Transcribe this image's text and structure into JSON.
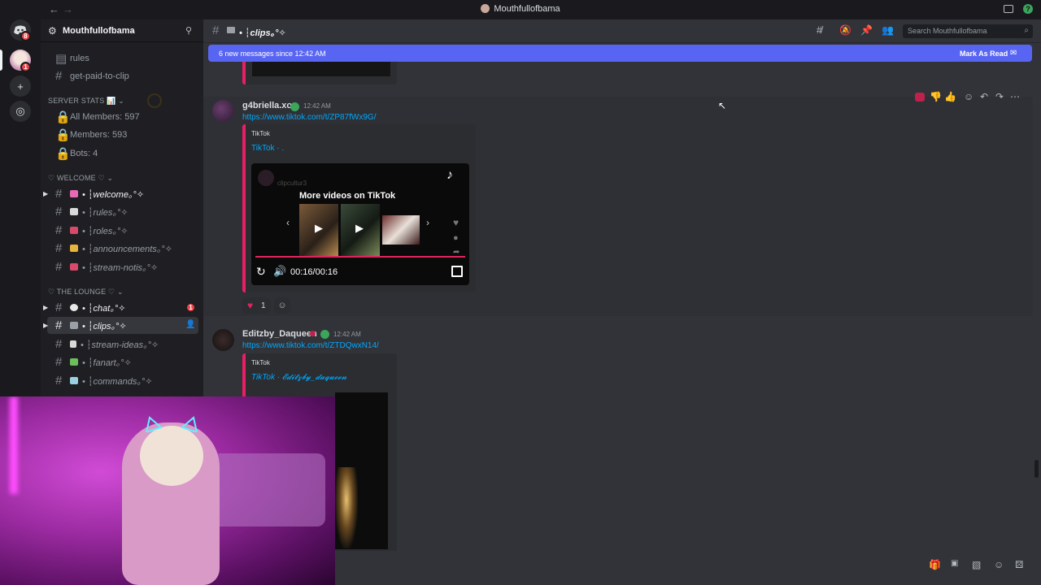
{
  "window": {
    "title": "Mouthfullofbama"
  },
  "rail": {
    "dm_badge": "8",
    "avatar_badge": "1"
  },
  "server": {
    "name": "Mouthfullofbama",
    "top_channels": [
      "rules",
      "get-paid-to-clip"
    ],
    "categories": [
      {
        "name": "SERVER STATS 📊",
        "items": [
          "All Members: 597",
          "Members: 593",
          "Bots: 4"
        ]
      },
      {
        "name": "♡ WELCOME ♡",
        "items": [
          "• ┆welcome｡°✧",
          "• ┆rules｡°✧",
          "• ┆roles｡°✧",
          "• ┆announcements｡°✧",
          "• ┆stream-notis｡°✧"
        ]
      },
      {
        "name": "♡ THE LOUNGE ♡",
        "items": [
          "• ┆chat｡°✧",
          "• ┆clips｡°✧",
          "• ┆stream-ideas｡°✧",
          "• ┆fanart｡°✧",
          "• ┆commands｡°✧"
        ]
      }
    ],
    "chat_badge": "1"
  },
  "channel": {
    "name": "• ┆clips｡°✧"
  },
  "search": {
    "placeholder": "Search Mouthfullofbama"
  },
  "banner": {
    "text": "6 new messages since 12:42 AM",
    "action": "Mark As Read"
  },
  "messages": [
    {
      "author": "g4briella.xo",
      "time": "12:42 AM",
      "link": "https://www.tiktok.com/t/ZP87fWx9G/",
      "embed": {
        "provider": "TikTok",
        "title": "TikTok · .",
        "video_user": "clipcultur3",
        "overlay": "More videos on TikTok",
        "time": "00:16/00:16"
      },
      "reaction_count": "1"
    },
    {
      "author": "Editzby_Daqueen",
      "time": "12:42 AM",
      "link": "https://www.tiktok.com/t/ZTDQwxN14/",
      "embed": {
        "provider": "TikTok",
        "title": "TikTok · 𝓔𝓭𝓲𝓽𝔃𝓫𝔂_𝓭𝓪𝓺𝓾𝓮𝓮𝓷"
      }
    }
  ],
  "colors": {
    "blurple": "#5865f2",
    "embed_border": "#e91e63",
    "link": "#00a8fc",
    "badge": "#ed4245"
  }
}
